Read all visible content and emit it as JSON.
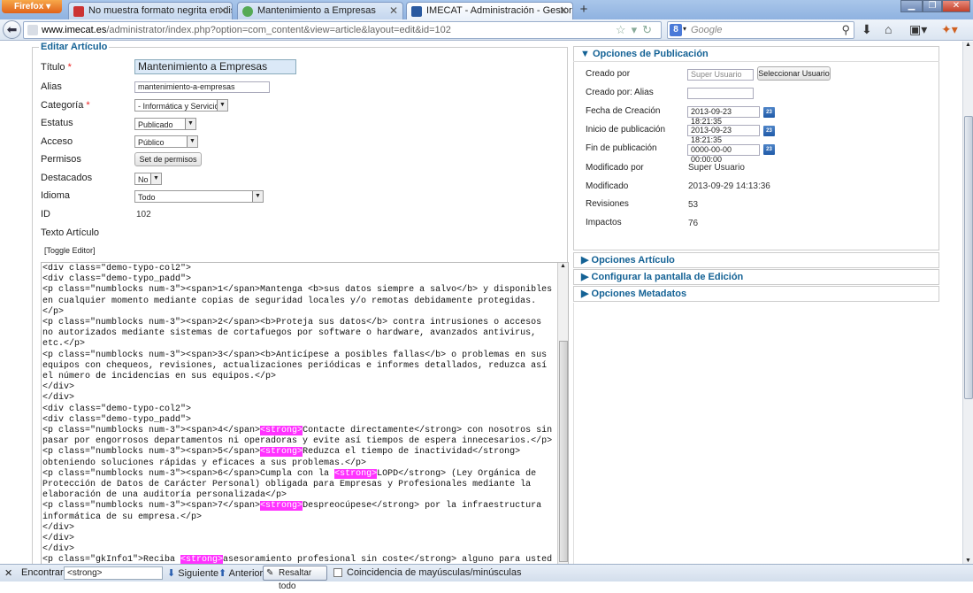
{
  "browser": {
    "menu_button": "Firefox",
    "tabs": [
      {
        "title": "No muestra formato negrita en dispo...",
        "active": false
      },
      {
        "title": "Mantenimiento a Empresas",
        "active": false
      },
      {
        "title": "IMECAT - Administración - Gestor de...",
        "active": true
      }
    ],
    "new_tab": "+",
    "url_domain": "www.imecat.es",
    "url_path": "/administrator/index.php?option=com_content&view=article&layout=edit&id=102",
    "search_engine": "8",
    "search_placeholder": "Google"
  },
  "form": {
    "legend": "Editar Artículo",
    "titulo_label": "Título",
    "titulo_value": "Mantenimiento a Empresas",
    "alias_label": "Alias",
    "alias_value": "mantenimiento-a-empresas",
    "categoria_label": "Categoría",
    "categoria_value": "- Informática y Servicios",
    "estatus_label": "Estatus",
    "estatus_value": "Publicado",
    "acceso_label": "Acceso",
    "acceso_value": "Público",
    "permisos_label": "Permisos",
    "permisos_button": "Set de permisos",
    "destacados_label": "Destacados",
    "destacados_value": "No",
    "idioma_label": "Idioma",
    "idioma_value": "Todo",
    "id_label": "ID",
    "id_value": "102",
    "texto_label": "Texto Artículo",
    "toggle_editor": "[Toggle Editor]",
    "required_mark": "*"
  },
  "editor_lines": [
    "<div class=\"demo-typo-col2\">",
    "<div class=\"demo-typo_padd\">",
    "<p class=\"numblocks num-3\"><span>1</span>Mantenga <b>sus datos siempre a salvo</b> y disponibles en cualquier momento mediante copias de seguridad locales y/o remotas debidamente protegidas.</p>",
    "<p class=\"numblocks num-3\"><span>2</span><b>Proteja sus datos</b> contra intrusiones o accesos no autorizados mediante sistemas de cortafuegos por software o hardware, avanzados antivirus, etc.</p>",
    "<p class=\"numblocks num-3\"><span>3</span><b>Anticípese a posibles fallas</b> o problemas en sus equipos con chequeos, revisiones, actualizaciones periódicas e informes detallados, reduzca así el número de incidencias en sus equipos.</p>",
    "</div>",
    "</div>",
    "<div class=\"demo-typo-col2\">",
    "<div class=\"demo-typo_padd\">",
    [
      "<p class=\"numblocks num-3\"><span>4</span>",
      "<strong>",
      "Contacte directamente</strong> con nosotros sin pasar por engorrosos departamentos ni operadoras y evite así tiempos de espera innecesarios.</p>"
    ],
    [
      "<p class=\"numblocks num-3\"><span>5</span>",
      "<strong>",
      "Reduzca el tiempo de inactividad</strong> obteniendo soluciones rápidas y eficaces a sus problemas.</p>"
    ],
    [
      "<p class=\"numblocks num-3\"><span>6</span>Cumpla con la ",
      "<strong>",
      "LOPD</strong> (Ley Orgánica de Protección de Datos de Carácter Personal) obligada para Empresas y Profesionales mediante la elaboración de una auditoría personalizada</p>"
    ],
    [
      "<p class=\"numblocks num-3\"><span>7</span>",
      "<strong>",
      "Despreocúpese</strong> por la infraestructura informática de su empresa.</p>"
    ],
    "</div>",
    "</div>",
    "</div>",
    [
      "<p class=\"gkInfo1\">Reciba ",
      "<strong>",
      "asesoramiento profesional sin coste</strong> alguno para usted al contratar nuestros servicios sobre cómo optimizar su sistema informático actual y garantizar un mejor rendimiento, elaboramos una auditoría completa de su infraestructura de red, inventario de sus ordenadores y"
    ]
  ],
  "publish": {
    "header": "Opciones de Publicación",
    "creado_por_label": "Creado por",
    "creado_por_placeholder": "Super Usuario",
    "seleccionar_button": "Seleccionar Usuario",
    "creado_alias_label": "Creado por: Alias",
    "fecha_creacion_label": "Fecha de Creación",
    "fecha_creacion_value": "2013-09-23 18:21:35",
    "inicio_label": "Inicio de publicación",
    "inicio_value": "2013-09-23 18:21:35",
    "fin_label": "Fin de publicación",
    "fin_value": "0000-00-00 00:00:00",
    "modificado_por_label": "Modificado por",
    "modificado_por_value": "Super Usuario",
    "modificado_label": "Modificado",
    "modificado_value": "2013-09-29 14:13:36",
    "revisiones_label": "Revisiones",
    "revisiones_value": "53",
    "impactos_label": "Impactos",
    "impactos_value": "76",
    "calendar_icon_text": "23"
  },
  "collapsed_panels": [
    "Opciones Artículo",
    "Configurar la pantalla de Edición",
    "Opciones Metadatos"
  ],
  "findbar": {
    "close": "✕",
    "label": "Encontrar:",
    "query": "<strong>",
    "next": "Siguiente",
    "previous": "Anterior",
    "highlight_all": "Resaltar todo",
    "match_case": "Coincidencia de mayúsculas/minúsculas"
  },
  "colors": {
    "accent": "#146295",
    "highlight": "#ff33ff"
  }
}
